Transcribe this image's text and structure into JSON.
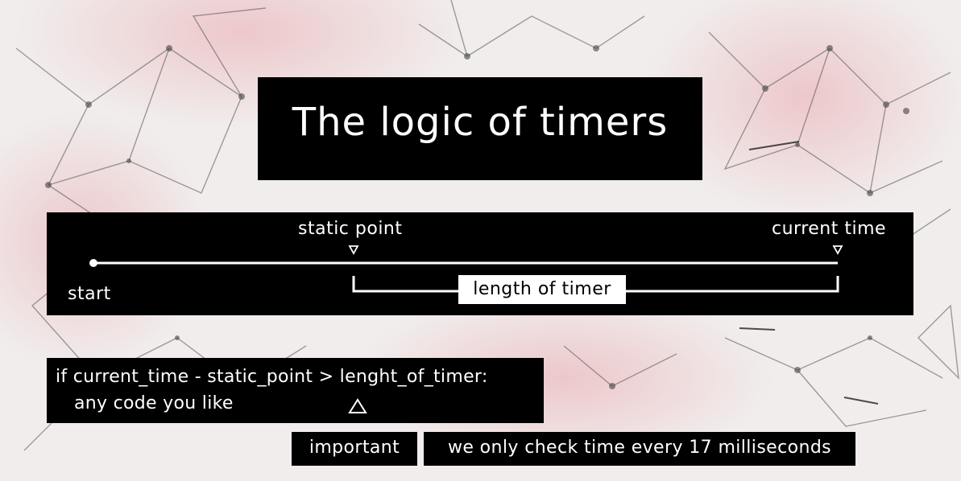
{
  "title": "The logic of timers",
  "timeline": {
    "static_point_label": "static point",
    "current_time_label": "current  time",
    "start_label": "start",
    "length_label": "length of timer"
  },
  "code": {
    "line1": "if current_time - static_point > lenght_of_timer:",
    "line2": "any code you like"
  },
  "notes": {
    "important": "important",
    "message": "we only check time every 17 milliseconds"
  },
  "colors": {
    "panel": "#000000",
    "text": "#ffffff",
    "accent_background": "#e8b4b8"
  }
}
